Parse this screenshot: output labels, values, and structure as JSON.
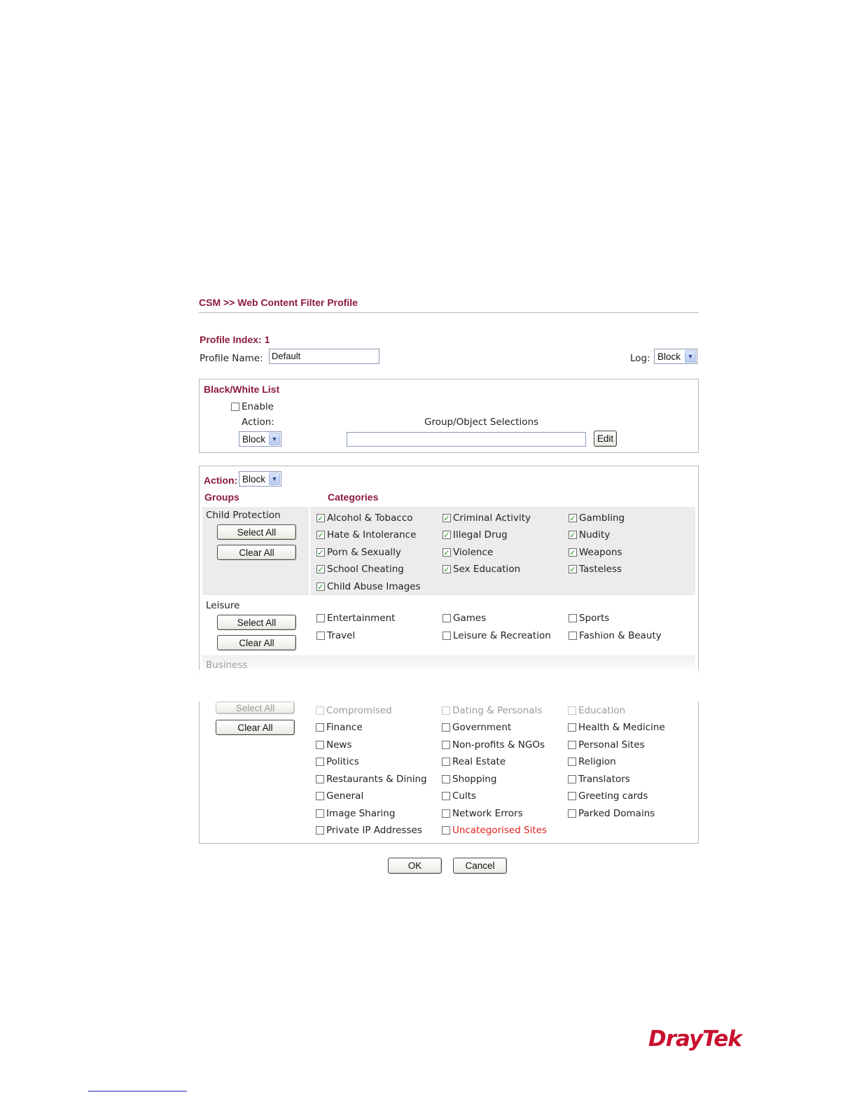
{
  "header": {
    "title": "CSM >> Web Content Filter Profile"
  },
  "profile": {
    "index_label": "Profile Index: 1",
    "name_label": "Profile Name:",
    "name_value": "Default",
    "log_label": "Log:",
    "log_value": "Block"
  },
  "bwlist": {
    "title": "Black/White List",
    "enable_label": "Enable",
    "enable_checked": false,
    "action_label": "Action:",
    "action_value": "Block",
    "selections_label": "Group/Object Selections",
    "selections_value": "",
    "edit_label": "Edit"
  },
  "filter": {
    "action_label": "Action:",
    "action_value": "Block",
    "groups_header": "Groups",
    "categories_header": "Categories",
    "select_all_label": "Select All",
    "clear_all_label": "Clear All",
    "groups": [
      {
        "name": "Child Protection",
        "categories": [
          {
            "label": "Alcohol & Tobacco",
            "checked": true
          },
          {
            "label": "Criminal Activity",
            "checked": true
          },
          {
            "label": "Gambling",
            "checked": true
          },
          {
            "label": "Hate & Intolerance",
            "checked": true
          },
          {
            "label": "Illegal Drug",
            "checked": true
          },
          {
            "label": "Nudity",
            "checked": true
          },
          {
            "label": "Porn & Sexually",
            "checked": true
          },
          {
            "label": "Violence",
            "checked": true
          },
          {
            "label": "Weapons",
            "checked": true
          },
          {
            "label": "School Cheating",
            "checked": true
          },
          {
            "label": "Sex Education",
            "checked": true
          },
          {
            "label": "Tasteless",
            "checked": true
          },
          {
            "label": "Child Abuse Images",
            "checked": true
          }
        ]
      },
      {
        "name": "Leisure",
        "categories": [
          {
            "label": "Entertainment",
            "checked": false
          },
          {
            "label": "Games",
            "checked": false
          },
          {
            "label": "Sports",
            "checked": false
          },
          {
            "label": "Travel",
            "checked": false
          },
          {
            "label": "Leisure & Recreation",
            "checked": false
          },
          {
            "label": "Fashion & Beauty",
            "checked": false
          }
        ]
      },
      {
        "name": "Business",
        "categories": [
          {
            "label": "Compromised",
            "checked": false
          },
          {
            "label": "Dating & Personals",
            "checked": false
          },
          {
            "label": "Education",
            "checked": false
          },
          {
            "label": "Finance",
            "checked": false
          },
          {
            "label": "Government",
            "checked": false
          },
          {
            "label": "Health & Medicine",
            "checked": false
          },
          {
            "label": "News",
            "checked": false
          },
          {
            "label": "Non-profits & NGOs",
            "checked": false
          },
          {
            "label": "Personal Sites",
            "checked": false
          },
          {
            "label": "Politics",
            "checked": false
          },
          {
            "label": "Real Estate",
            "checked": false
          },
          {
            "label": "Religion",
            "checked": false
          },
          {
            "label": "Restaurants & Dining",
            "checked": false
          },
          {
            "label": "Shopping",
            "checked": false
          },
          {
            "label": "Translators",
            "checked": false
          },
          {
            "label": "General",
            "checked": false
          },
          {
            "label": "Cults",
            "checked": false
          },
          {
            "label": "Greeting cards",
            "checked": false
          },
          {
            "label": "Image Sharing",
            "checked": false
          },
          {
            "label": "Network Errors",
            "checked": false
          },
          {
            "label": "Parked Domains",
            "checked": false
          },
          {
            "label": "Private IP Addresses",
            "checked": false
          },
          {
            "label": "Uncategorised Sites",
            "checked": false
          }
        ]
      }
    ]
  },
  "footer_buttons": {
    "ok": "OK",
    "cancel": "Cancel"
  },
  "colors": {
    "heading": "#8b1a3a",
    "uncategorised": "#e02020",
    "checkmark": "#1f8f1f"
  },
  "logo_text": "DrayTek"
}
